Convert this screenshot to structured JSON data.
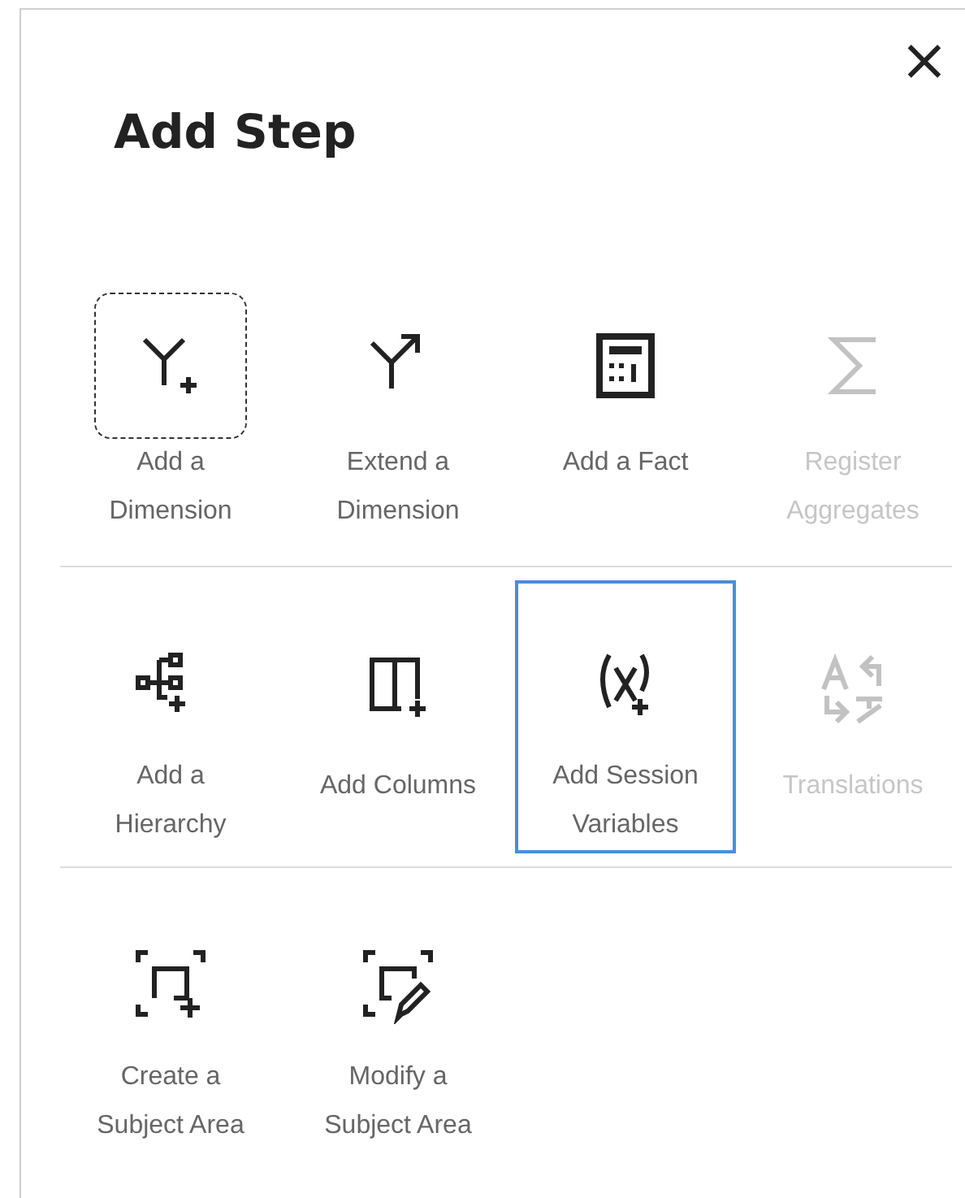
{
  "dialog": {
    "title": "Add Step",
    "close": "×"
  },
  "rows": [
    [
      {
        "label": "Add a Dimension",
        "focused": true,
        "selected": false,
        "disabled": false
      },
      {
        "label": "Extend a Dimension",
        "focused": false,
        "selected": false,
        "disabled": false
      },
      {
        "label": "Add a Fact",
        "focused": false,
        "selected": false,
        "disabled": false
      },
      {
        "label": "Register Aggregates",
        "focused": false,
        "selected": false,
        "disabled": true
      }
    ],
    [
      {
        "label": "Add a Hierarchy",
        "focused": false,
        "selected": false,
        "disabled": false
      },
      {
        "label": "Add Columns",
        "focused": false,
        "selected": false,
        "disabled": false
      },
      {
        "label": "Add Session Variables",
        "focused": false,
        "selected": true,
        "disabled": false
      },
      {
        "label": "Translations",
        "focused": false,
        "selected": false,
        "disabled": true
      }
    ],
    [
      {
        "label": "Create a Subject Area",
        "focused": false,
        "selected": false,
        "disabled": false
      },
      {
        "label": "Modify a Subject Area",
        "focused": false,
        "selected": false,
        "disabled": false
      }
    ]
  ]
}
